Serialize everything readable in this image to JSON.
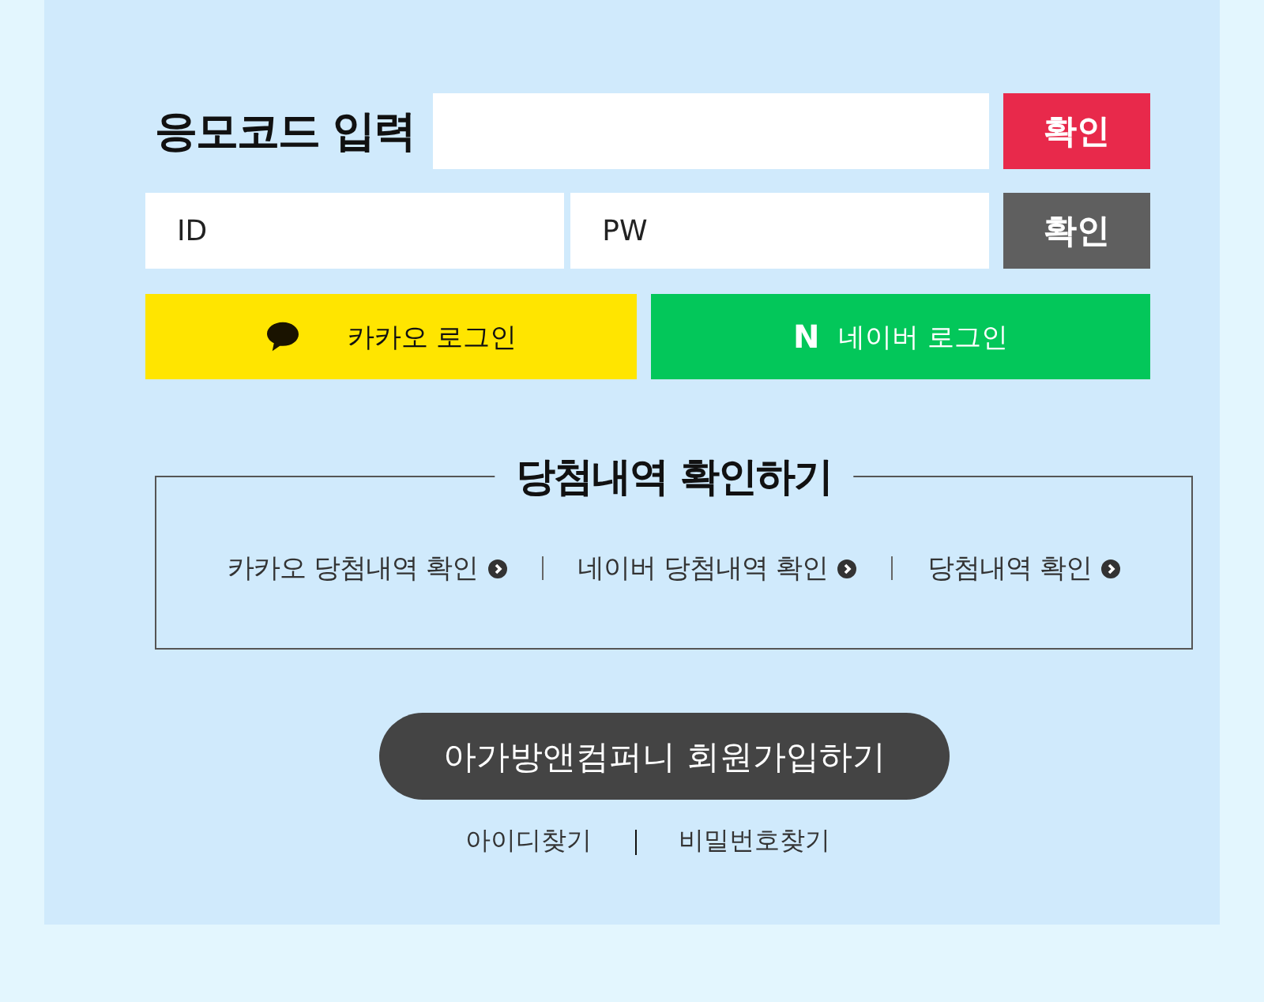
{
  "coupon": {
    "label": "응모코드 입력",
    "button": "확인"
  },
  "login": {
    "id_placeholder": "ID",
    "pw_placeholder": "PW",
    "button": "확인"
  },
  "social": [
    {
      "kind": "kakao",
      "label": "카카오 로그인"
    },
    {
      "kind": "naver",
      "mark": "N",
      "label": "네이버 로그인"
    }
  ],
  "history": {
    "title": "당첨내역 확인하기",
    "links": [
      "카카오 당첨내역 확인",
      "네이버 당첨내역 확인",
      "당첨내역 확인"
    ]
  },
  "signup": "아가방앤컴퍼니 회원가입하기",
  "find_links": [
    "아이디찾기",
    "비밀번호찾기"
  ]
}
